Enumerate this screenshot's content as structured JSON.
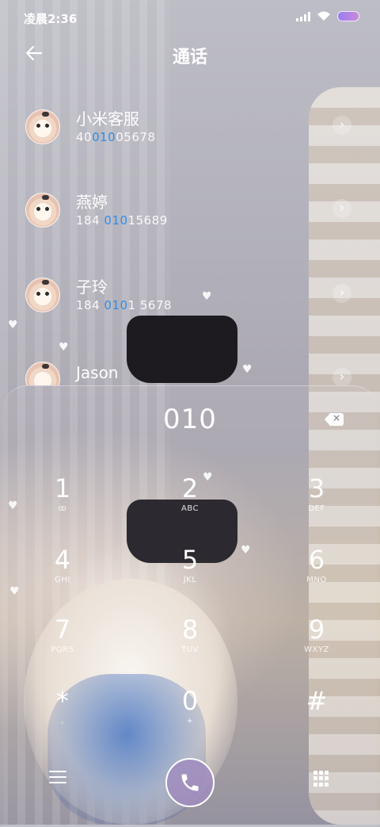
{
  "status_bar": {
    "time": "凌晨2:36",
    "icons": [
      "signal-icon",
      "wifi-icon",
      "battery-icon"
    ],
    "battery_color": "#a98be8"
  },
  "header": {
    "back_icon": "arrow-left-icon",
    "title": "通话"
  },
  "contacts": [
    {
      "name": "小米客服",
      "number_pre": "40",
      "number_hl": "010",
      "number_post": "05678"
    },
    {
      "name": "燕婷",
      "number_pre": "184 ",
      "number_hl": "010",
      "number_post": "15689"
    },
    {
      "name": "子玲",
      "number_pre": "184 ",
      "number_hl": "010",
      "number_post": "1 5678"
    },
    {
      "name": "Jason",
      "number_pre": "",
      "number_hl": "",
      "number_post": ""
    }
  ],
  "highlight_color": "#2d8ee8",
  "dialpad": {
    "entry": "010",
    "keys": [
      {
        "digit": "1",
        "letters": "ꝏ"
      },
      {
        "digit": "2",
        "letters": "ABC"
      },
      {
        "digit": "3",
        "letters": "DEF"
      },
      {
        "digit": "4",
        "letters": "GHI"
      },
      {
        "digit": "5",
        "letters": "JKL"
      },
      {
        "digit": "6",
        "letters": "MNO"
      },
      {
        "digit": "7",
        "letters": "PQRS"
      },
      {
        "digit": "8",
        "letters": "TUV"
      },
      {
        "digit": "9",
        "letters": "WXYZ"
      },
      {
        "digit": "*",
        "letters": ","
      },
      {
        "digit": "0",
        "letters": "+"
      },
      {
        "digit": "#",
        "letters": ""
      }
    ],
    "menu_icon": "hamburger-menu-icon",
    "call_icon": "phone-icon",
    "keypad_icon": "keypad-grid-icon"
  }
}
